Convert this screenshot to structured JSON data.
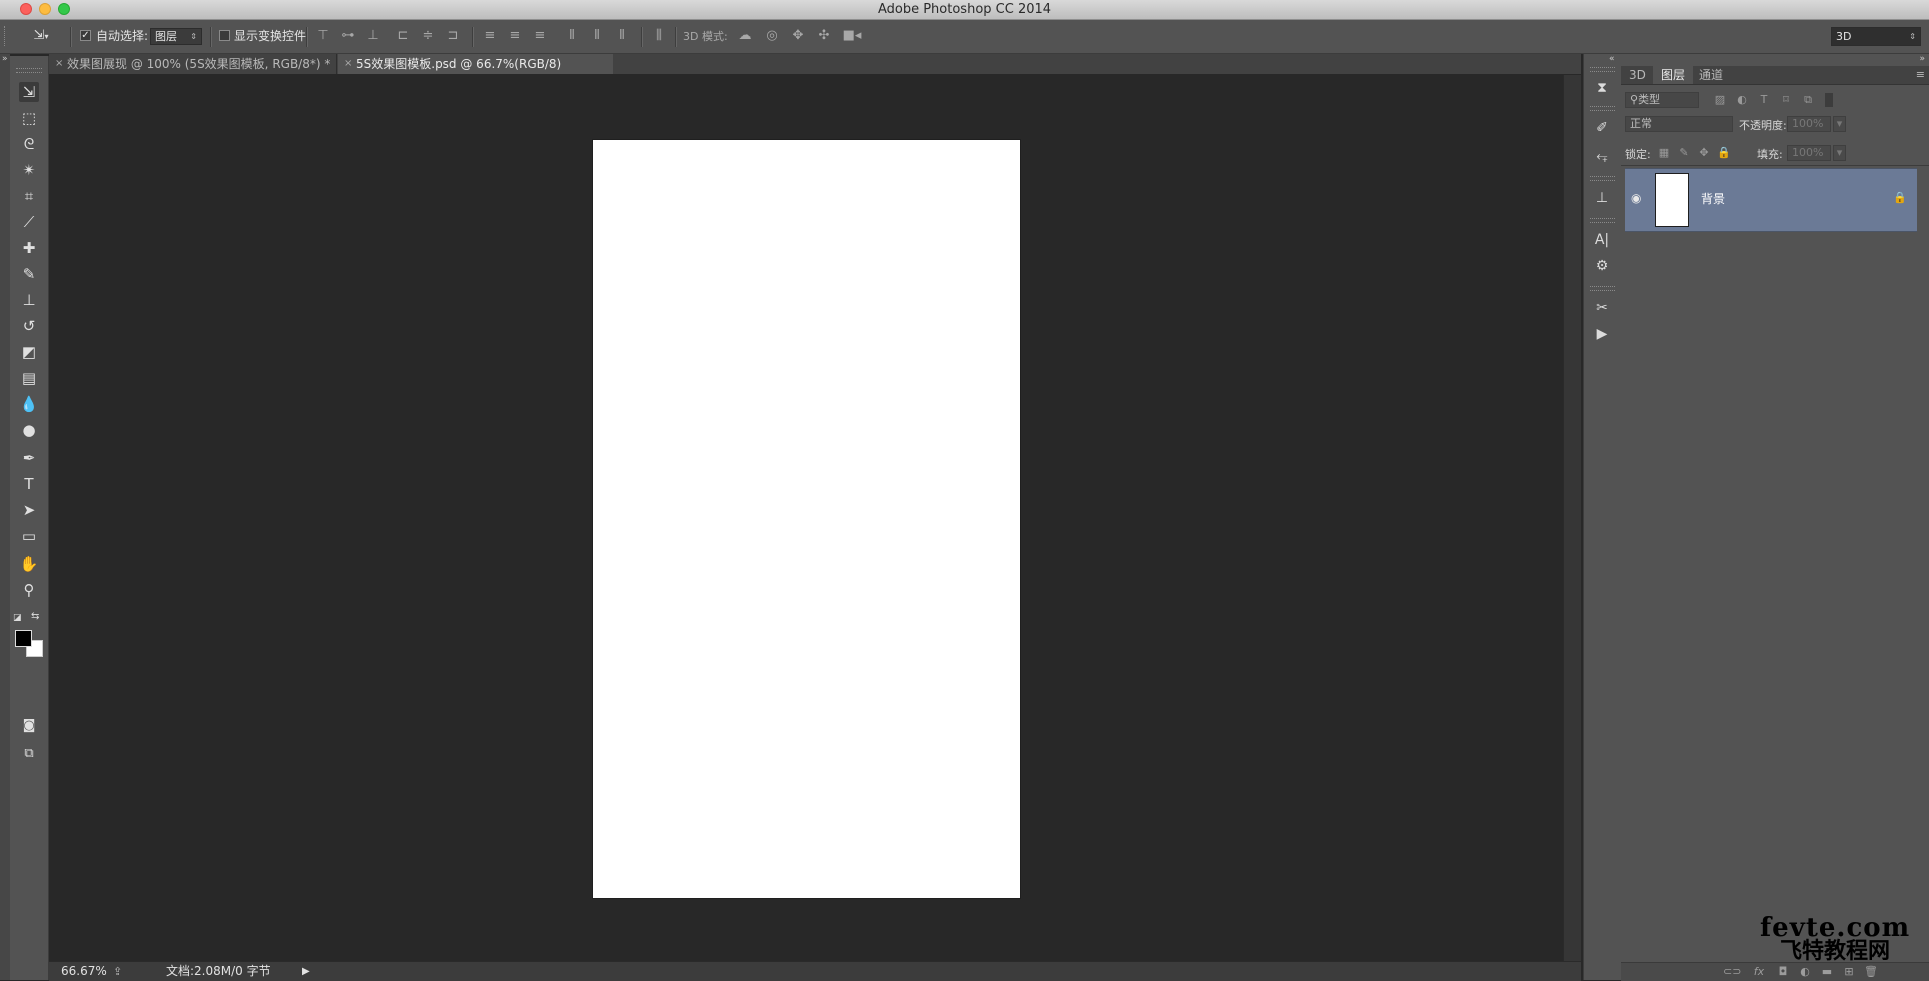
{
  "window": {
    "title": "Adobe Photoshop CC 2014"
  },
  "options_bar": {
    "auto_select_label": "自动选择:",
    "auto_select_checked": true,
    "auto_select_value": "图层",
    "show_transform_label": "显示变换控件",
    "show_transform_checked": false,
    "mode_3d_label": "3D 模式:",
    "workspace_value": "3D"
  },
  "document_tabs": [
    {
      "label": "效果图展现 @ 100% (5S效果图模板, RGB/8*) *",
      "active": false
    },
    {
      "label": "5S效果图模板.psd @ 66.7%(RGB/8)",
      "active": true
    }
  ],
  "status_bar": {
    "zoom": "66.67%",
    "doc_info": "文档:2.08M/0 字节"
  },
  "layers_panel": {
    "tabs": [
      "3D",
      "图层",
      "通道"
    ],
    "active_tab": "图层",
    "filter_kind": "类型",
    "blend_mode": "正常",
    "opacity_label": "不透明度:",
    "opacity_value": "100%",
    "lock_label": "锁定:",
    "fill_label": "填充:",
    "fill_value": "100%",
    "layers": [
      {
        "name": "背景",
        "visible": true,
        "locked": true
      }
    ]
  },
  "colors": {
    "foreground": "#000000",
    "background": "#ffffff",
    "selected_layer": "#6b7a96",
    "canvas": "#ffffff"
  },
  "watermark": {
    "line1": "fevte.com",
    "line2": "飞特教程网"
  }
}
